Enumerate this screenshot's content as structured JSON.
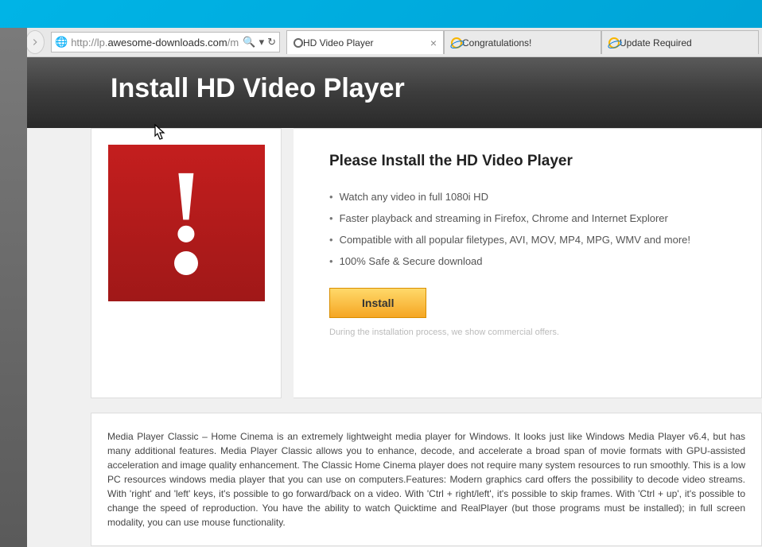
{
  "browser": {
    "url_prefix": "http://lp.",
    "url_domain": "awesome-downloads.com",
    "url_suffix": "/mp",
    "tabs": [
      {
        "title": "HD Video Player",
        "active": true
      },
      {
        "title": "Congratulations!",
        "active": false
      },
      {
        "title": "Update Required",
        "active": false
      }
    ]
  },
  "page": {
    "header_title": "Install HD Video Player",
    "subtitle": "Please Install the HD Video Player",
    "features": [
      "Watch any video in full 1080i HD",
      "Faster playback and streaming in Firefox, Chrome and Internet Explorer",
      "Compatible with all popular filetypes, AVI, MOV, MP4, MPG, WMV and more!",
      "100% Safe & Secure download"
    ],
    "install_label": "Install",
    "disclaimer": "During the installation process, we show commercial offers.",
    "description": "Media Player Classic – Home Cinema is an extremely lightweight media player for Windows. It looks just like Windows Media Player v6.4, but has many additional features. Media Player Classic allows you to enhance, decode, and accelerate a broad span of movie formats with GPU-assisted acceleration and image quality enhancement. The Classic Home Cinema player does not require many system resources to run smoothly. This is a low PC resources windows media player that you can use on computers.Features: Modern graphics card offers the possibility to decode video streams. With 'right' and 'left' keys, it's possible to go forward/back on a video. With 'Ctrl + right/left', it's possible to skip frames. With 'Ctrl + up', it's possible to change the speed of reproduction. You have the ability to watch Quicktime and RealPlayer (but those programs must be installed); in full screen modality, you can use mouse functionality."
  }
}
